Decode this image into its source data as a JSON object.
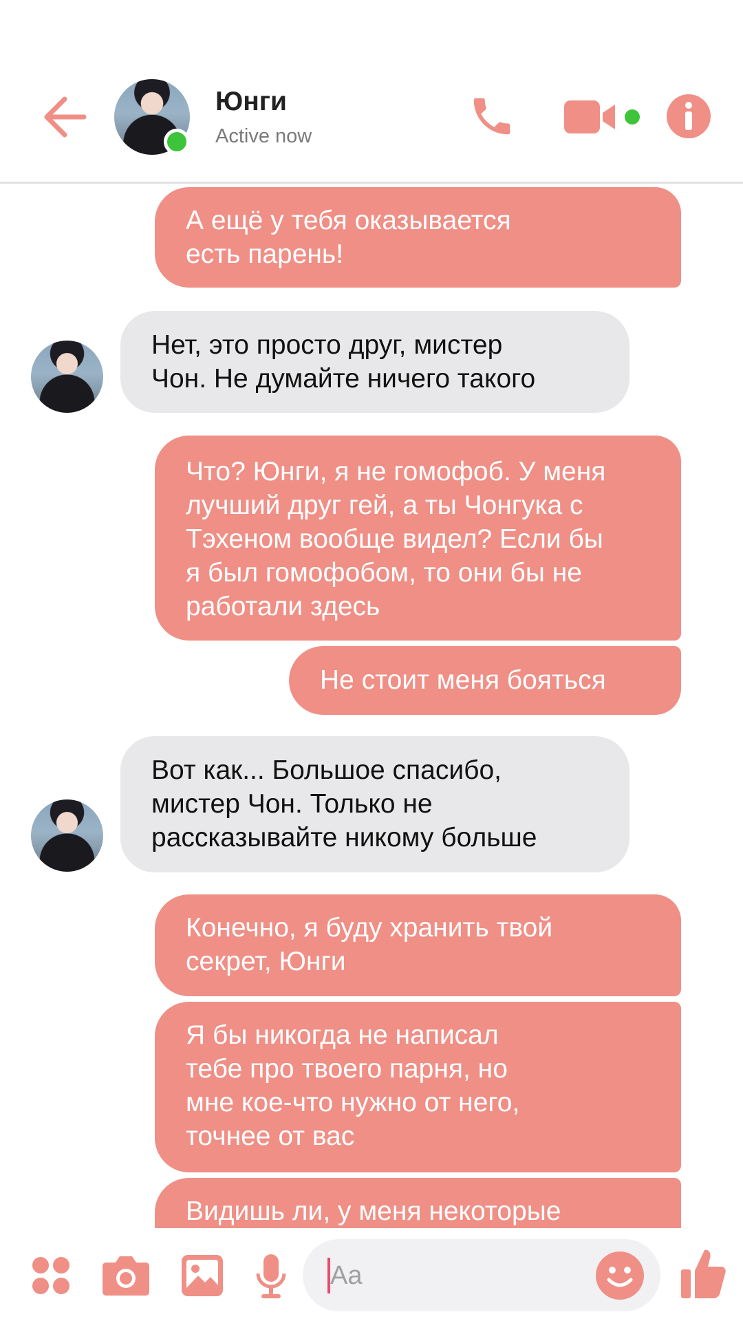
{
  "header": {
    "contact_name": "Юнги",
    "status": "Active now",
    "icons": [
      "back-arrow-icon",
      "phone-icon",
      "video-camera-icon",
      "info-icon"
    ],
    "accent_color": "#ef8f86",
    "online_color": "#3ec43a"
  },
  "messages": [
    {
      "from": "me",
      "text": "А ещё у тебя оказывается\nесть парень!"
    },
    {
      "from": "contact",
      "text": "Нет, это просто друг, мистер\nЧон. Не думайте ничего такого"
    },
    {
      "from": "me",
      "text": "Что? Юнги, я не гомофоб. У меня\nлучший друг гей, а ты Чонгука с\nТэхеном вообще видел? Если бы\nя был гомофобом, то они бы не\nработали здесь"
    },
    {
      "from": "me",
      "text": "Не стоит меня бояться"
    },
    {
      "from": "contact",
      "text": "Вот как... Большое спасибо,\nмистер Чон. Только не\nрассказывайте никому больше"
    },
    {
      "from": "me",
      "text": "Конечно, я буду хранить твой\nсекрет, Юнги"
    },
    {
      "from": "me",
      "text": "Я бы никогда не написал\nтебе про твоего парня, но\nмне кое-что нужно от него,\nточнее от вас"
    },
    {
      "from": "me",
      "text": "Видишь ли, у меня некоторые"
    }
  ],
  "composer": {
    "placeholder": "Aa",
    "icons": [
      "apps-icon",
      "camera-icon",
      "gallery-icon",
      "microphone-icon",
      "emoji-icon",
      "thumbs-up-icon"
    ]
  },
  "colors": {
    "outgoing_bubble": "#ef8f86",
    "incoming_bubble": "#e8e8ea"
  }
}
